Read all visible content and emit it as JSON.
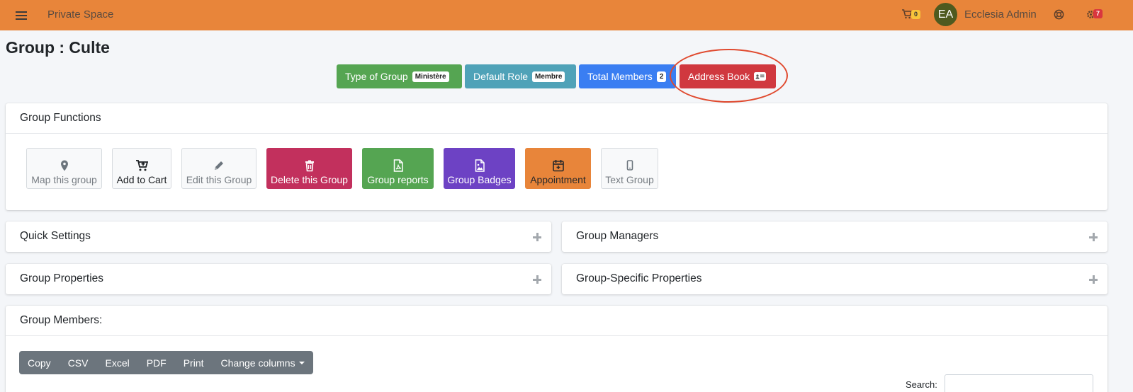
{
  "navbar": {
    "title": "Private Space",
    "cart_count": "0",
    "avatar_initials": "EA",
    "user_name": "Ecclesia Admin",
    "notifications_count": "7",
    "color": "#e8853a"
  },
  "page": {
    "title": "Group : Culte"
  },
  "info_buttons": {
    "type_label": "Type of Group",
    "type_value": "Ministère",
    "role_label": "Default Role",
    "role_value": "Membre",
    "total_label": "Total Members",
    "total_value": "2",
    "address_label": "Address Book"
  },
  "group_functions": {
    "title": "Group Functions",
    "map": "Map this group",
    "cart": "Add to Cart",
    "edit": "Edit this Group",
    "delete": "Delete this Group",
    "reports": "Group reports",
    "badges": "Group Badges",
    "appointment": "Appointment",
    "text": "Text Group"
  },
  "panels": {
    "quick_settings": "Quick Settings",
    "group_managers": "Group Managers",
    "group_properties": "Group Properties",
    "group_specific": "Group-Specific Properties"
  },
  "members": {
    "title": "Group Members:",
    "buttons": [
      "Copy",
      "CSV",
      "Excel",
      "PDF",
      "Print",
      "Change columns"
    ],
    "search_label": "Search:"
  }
}
